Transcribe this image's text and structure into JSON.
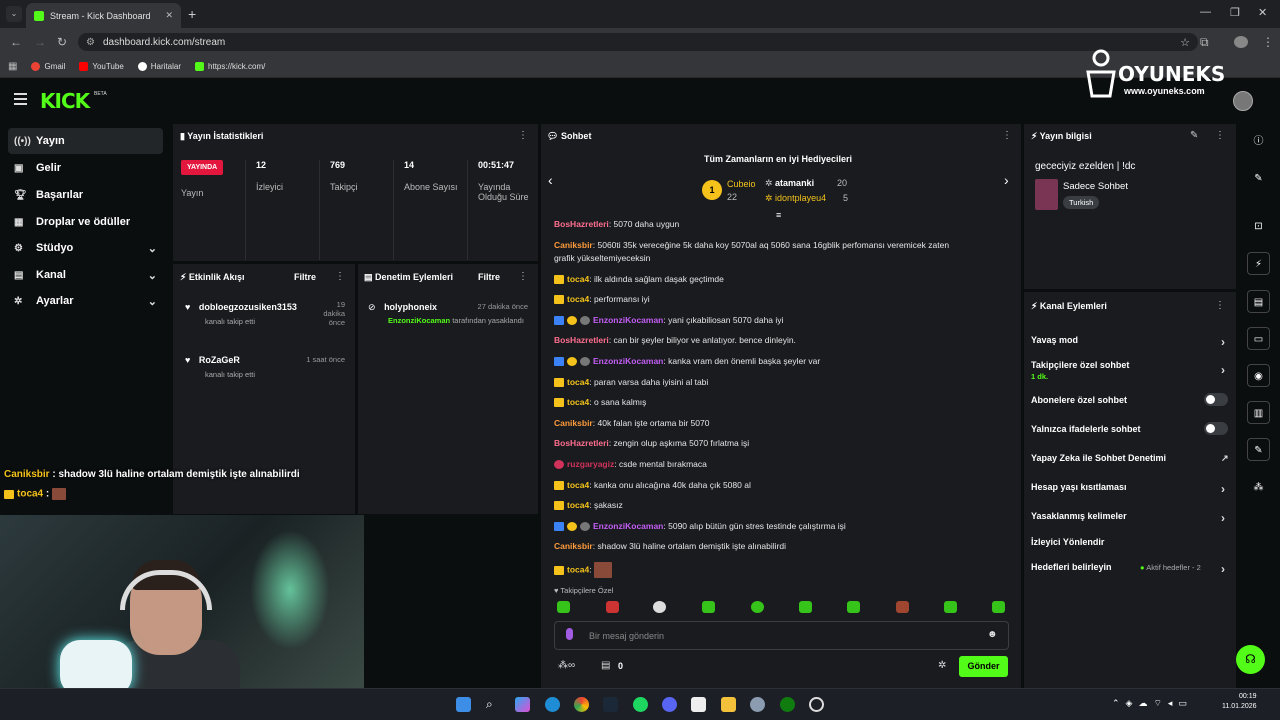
{
  "browser": {
    "tab_title": "Stream - Kick Dashboard",
    "url": "dashboard.kick.com/stream",
    "bookmarks": [
      "Gmail",
      "YouTube",
      "Haritalar",
      "https://kick.com/"
    ]
  },
  "brand": {
    "logo": "KICK",
    "beta": "BETA",
    "watermark": "OYUNEKS",
    "watermark_url": "www.oyuneks.com"
  },
  "sidebar": {
    "items": [
      {
        "label": "Yayın",
        "icon": "broadcast-icon"
      },
      {
        "label": "Gelir",
        "icon": "money-icon"
      },
      {
        "label": "Başarılar",
        "icon": "trophy-icon"
      },
      {
        "label": "Droplar ve ödüller",
        "icon": "gift-icon"
      },
      {
        "label": "Stüdyo",
        "icon": "studio-icon"
      },
      {
        "label": "Kanal",
        "icon": "channel-icon"
      },
      {
        "label": "Ayarlar",
        "icon": "gear-icon"
      }
    ]
  },
  "stats": {
    "title": "Yayın İstatistikleri",
    "live_badge": "YAYINDA",
    "live_label": "Yayın",
    "items": [
      {
        "value": "12",
        "label": "İzleyici"
      },
      {
        "value": "769",
        "label": "Takipçi"
      },
      {
        "value": "14",
        "label": "Abone Sayısı"
      },
      {
        "value": "00:51:47",
        "label": "Yayında Olduğu Süre"
      }
    ]
  },
  "activity": {
    "title": "Etkinlik Akışı",
    "filter": "Filtre",
    "events": [
      {
        "user": "dobloegzozusiken3153",
        "text": "kanalı takip etti",
        "time": "19 dakika önce"
      },
      {
        "user": "RoZaGeR",
        "text": "kanalı takip etti",
        "time": "1 saat önce"
      }
    ]
  },
  "moderation": {
    "title": "Denetim Eylemleri",
    "filter": "Filtre",
    "events": [
      {
        "user": "holyphoneix",
        "time": "27 dakika önce",
        "mod": "EnzonziKocaman",
        "text": "tarafından yasaklandı"
      }
    ]
  },
  "chat": {
    "title": "Sohbet",
    "top_title": "Tüm Zamanların en iyi Hediyecileri",
    "top": [
      {
        "rank": "1",
        "name": "Cubeio",
        "amount": "22"
      },
      {
        "name": "atamanki",
        "amount": "20"
      },
      {
        "name": "idontplayeu4",
        "amount": "5"
      }
    ],
    "messages": [
      {
        "user": "BosHazretleri",
        "text": "5070 daha uygun",
        "c": "c-pk",
        "b": ""
      },
      {
        "user": "Caniksbir",
        "text": "5060ti 35k vereceğine 5k daha koy 5070al aq 5060 sana 16gblik perfomansı veremicek zaten",
        "c": "c-o",
        "b": ""
      },
      {
        "user": "",
        "text": "grafik yükseltemiyeceksin",
        "c": "",
        "b": ""
      },
      {
        "user": "toca4",
        "text": "ilk aldında sağlam daşak geçtimde",
        "c": "c-y",
        "b": "crown"
      },
      {
        "user": "toca4",
        "text": "performansı iyi",
        "c": "c-y",
        "b": "crown"
      },
      {
        "user": "EnzonziKocaman",
        "text": "yani çıkabiliosan 5070 daha iyi",
        "c": "c-p",
        "b": "mod"
      },
      {
        "user": "BosHazretleri",
        "text": "can bir şeyler biliyor ve anlatıyor. bence dinleyin.",
        "c": "c-pk",
        "b": ""
      },
      {
        "user": "EnzonziKocaman",
        "text": "kanka vram den önemli başka şeyler var",
        "c": "c-p",
        "b": "mod"
      },
      {
        "user": "toca4",
        "text": "paran varsa daha iyisini al tabi",
        "c": "c-y",
        "b": "crown"
      },
      {
        "user": "toca4",
        "text": "o sana kalmış",
        "c": "c-y",
        "b": "crown"
      },
      {
        "user": "Caniksbir",
        "text": "40k falan işte ortama bir 5070",
        "c": "c-o",
        "b": ""
      },
      {
        "user": "BosHazretleri",
        "text": "zengin olup aşkıma 5070 fırlatma işi",
        "c": "c-pk",
        "b": ""
      },
      {
        "user": "ruzgaryagiz",
        "text": "csde mental bırakmaca",
        "c": "c-r",
        "b": "gear"
      },
      {
        "user": "toca4",
        "text": "kanka onu alıcağına 40k daha çık 5080 al",
        "c": "c-y",
        "b": "crown"
      },
      {
        "user": "toca4",
        "text": "şakasız",
        "c": "c-y",
        "b": "crown"
      },
      {
        "user": "EnzonziKocaman",
        "text": "5090 alıp bütün gün stres testinde çalıştırma işi",
        "c": "c-p",
        "b": "mod"
      },
      {
        "user": "Caniksbir",
        "text": "shadow 3lü haline ortalam demiştik işte alınabilirdi",
        "c": "c-o",
        "b": ""
      },
      {
        "user": "toca4",
        "text": "",
        "c": "c-y",
        "b": "crown"
      }
    ],
    "followers_only": "Takipçilere Özel",
    "placeholder": "Bir mesaj gönderin",
    "count": "0",
    "send": "Gönder"
  },
  "info": {
    "title": "Yayın bilgisi",
    "stream_title": "gececiyiz ezelden | !dc",
    "category": "Sadece Sohbet",
    "language": "Turkish"
  },
  "channel_actions": {
    "title": "Kanal Eylemleri",
    "items": [
      "Yavaş mod",
      "Takipçilere özel sohbet",
      "Abonelere özel sohbet",
      "Yalnızca ifadelerle sohbet",
      "Yapay Zeka ile Sohbet Denetimi",
      "Hesap yaşı kısıtlaması",
      "Yasaklanmış kelimeler",
      "İzleyici Yönlendir",
      "Hedefleri belirleyin"
    ],
    "follower_delay": "1 dk.",
    "goals_status": "Aktif hedefler - 2"
  },
  "overlay": {
    "line1_user": "Caniksbir",
    "line1_text": " : shadow 3lü haline ortalam demiştik işte alınabilirdi",
    "line2_user": "toca4",
    "line2_text": " :"
  },
  "clock": {
    "time": "00:19",
    "date": "11.01.2026"
  },
  "colors": {
    "accent": "#53fc18",
    "live": "#e3173d"
  }
}
